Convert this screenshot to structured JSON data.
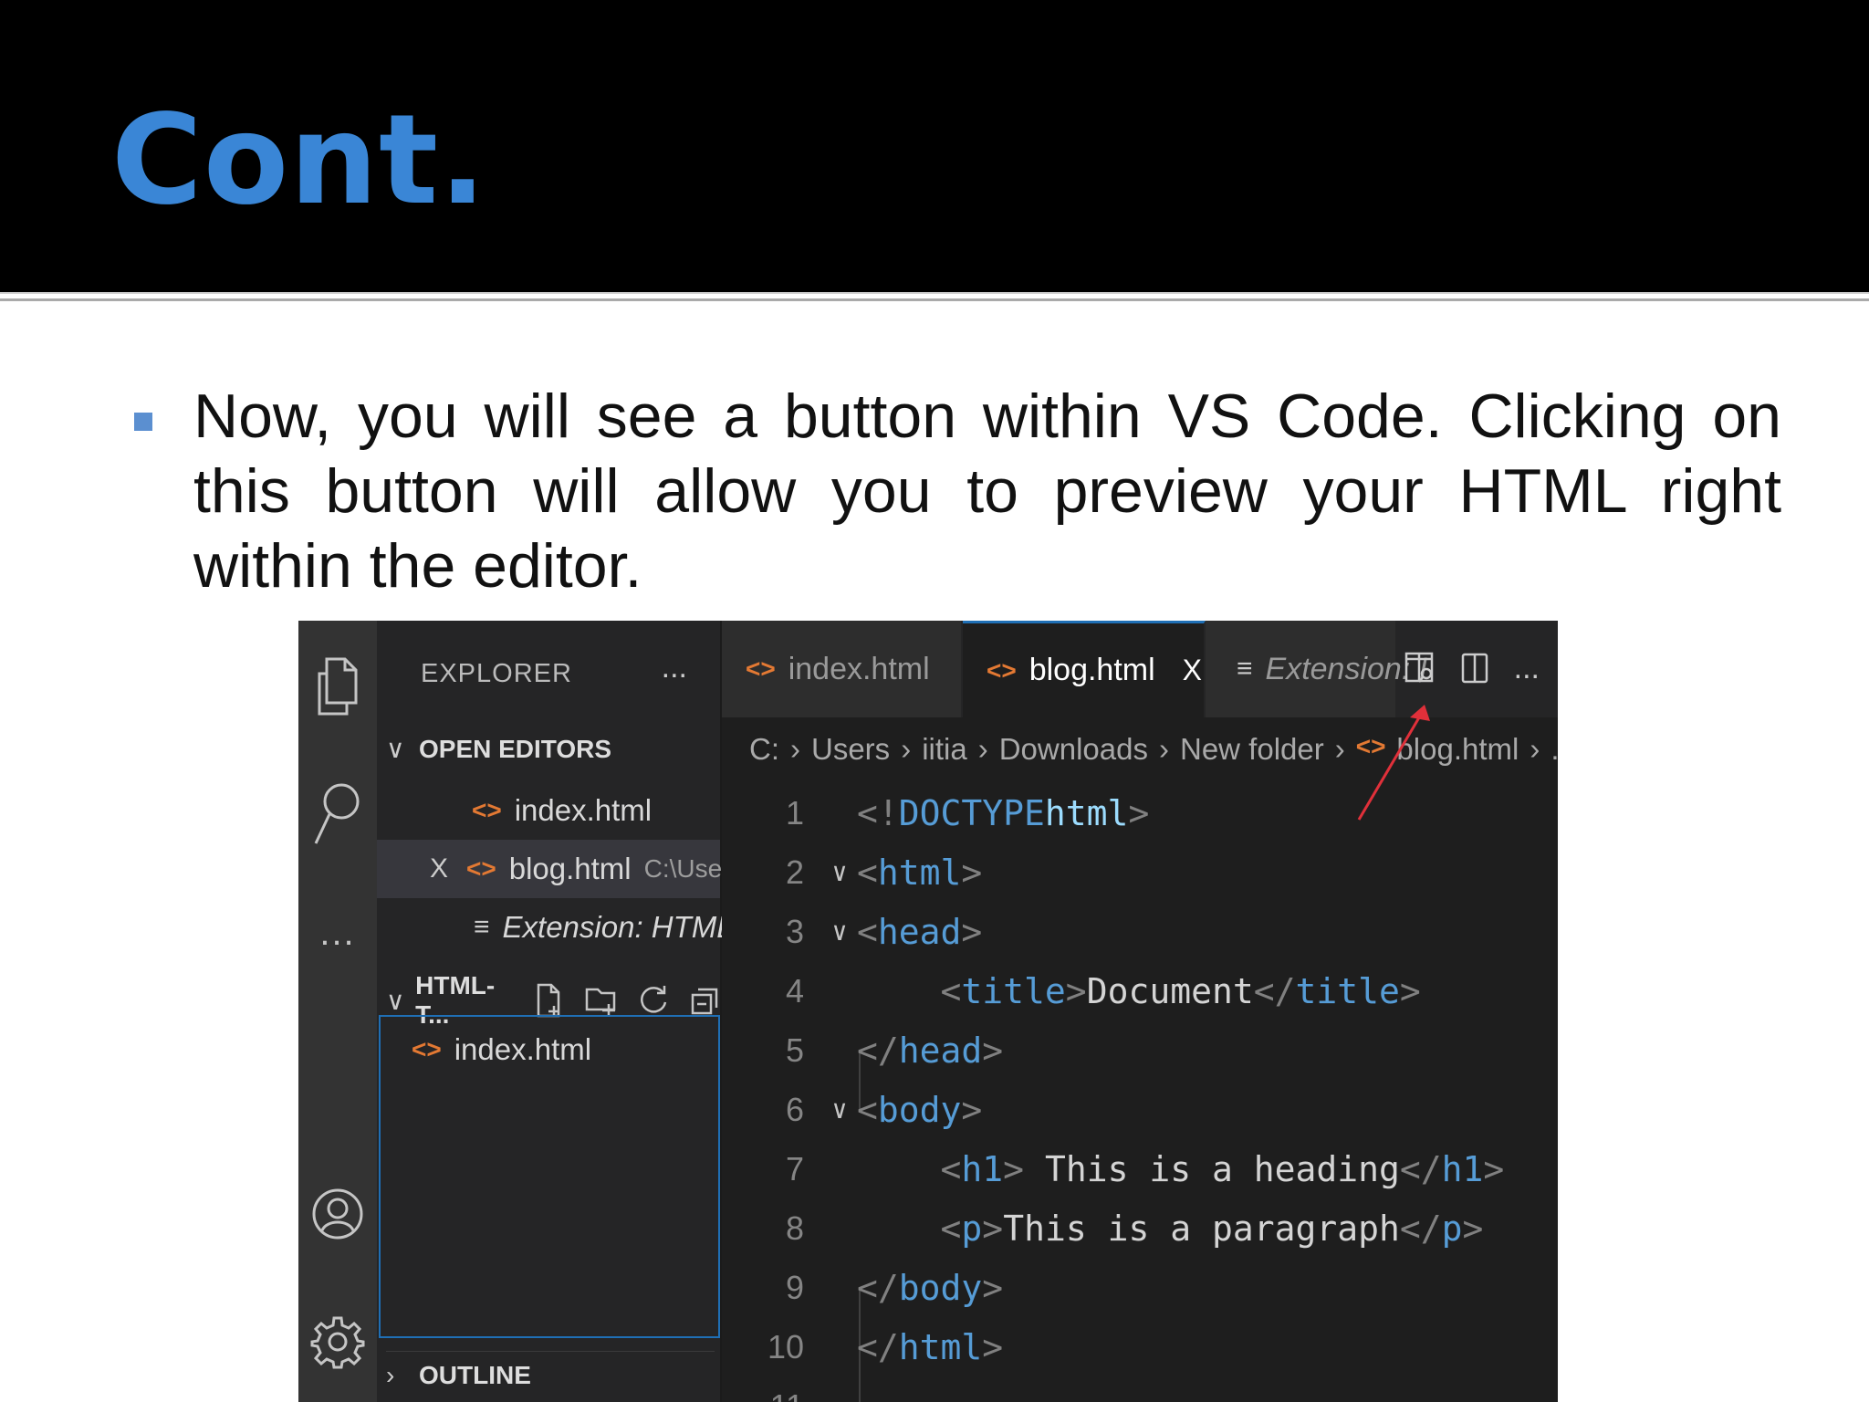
{
  "slide": {
    "title": "Cont.",
    "bullet": "Now, you will see a button within VS Code. Clicking on this button will allow you to preview your HTML right within the editor.",
    "accent_color": "#3a86d6",
    "bullet_color": "#5b8fd0"
  },
  "vscode": {
    "activity_bar": {
      "icons": [
        "explorer-icon",
        "search-icon",
        "more-icon",
        "account-icon",
        "settings-gear-icon"
      ],
      "more_label": "..."
    },
    "sidebar": {
      "title": "EXPLORER",
      "more_label": "...",
      "open_editors": {
        "header": "OPEN EDITORS",
        "items": [
          {
            "name": "index.html",
            "path": ""
          },
          {
            "name": "blog.html",
            "path": "C:\\Use..."
          },
          {
            "name": "Extension: HTML...",
            "path": ""
          }
        ]
      },
      "folder": {
        "header": "HTML-T...",
        "files": [
          "index.html"
        ]
      },
      "outline_header": "OUTLINE"
    },
    "tabs": [
      {
        "label": "index.html",
        "active": false
      },
      {
        "label": "blog.html",
        "active": true
      },
      {
        "label": "Extension: I",
        "active": false
      }
    ],
    "tab_more": "...",
    "tab_close": "X",
    "breadcrumb": [
      "C:",
      "Users",
      "iitia",
      "Downloads",
      "New folder",
      "blog.html",
      "..."
    ],
    "code_lines": [
      {
        "n": "1",
        "text": "<!DOCTYPE html>"
      },
      {
        "n": "2",
        "text": "<html>"
      },
      {
        "n": "3",
        "text": "<head>"
      },
      {
        "n": "4",
        "text": "<title>Document</title>"
      },
      {
        "n": "5",
        "text": "</head>"
      },
      {
        "n": "6",
        "text": "<body>"
      },
      {
        "n": "7",
        "text": "<h1> This is a heading</h1>"
      },
      {
        "n": "8",
        "text": "<p>This is a paragraph</p>"
      },
      {
        "n": "9",
        "text": "</body>"
      },
      {
        "n": "10",
        "text": "</html>"
      },
      {
        "n": "11",
        "text": ""
      }
    ],
    "annotation_arrow_color": "#e0303a"
  }
}
